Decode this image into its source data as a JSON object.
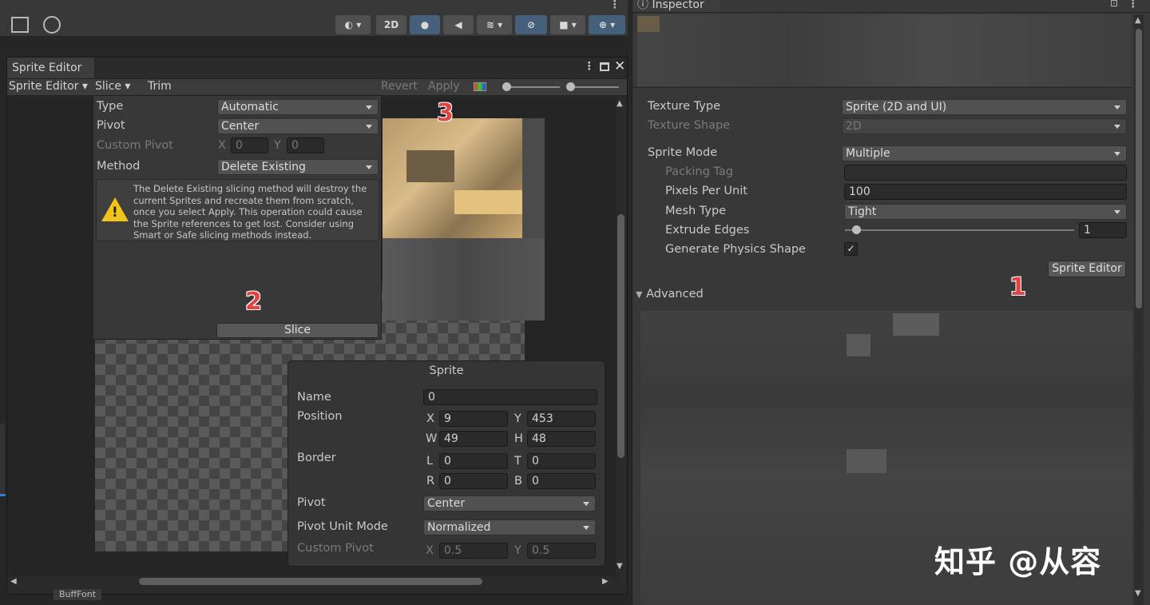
{
  "scene_toolbar": {
    "mode_2d": "2D"
  },
  "sprite_editor": {
    "tab_title": "Sprite Editor",
    "toolbar": {
      "mode_menu": "Sprite Editor",
      "slice": "Slice",
      "trim": "Trim",
      "revert": "Revert",
      "apply": "Apply"
    },
    "slice_popup": {
      "type_label": "Type",
      "type_value": "Automatic",
      "pivot_label": "Pivot",
      "pivot_value": "Center",
      "custom_pivot_label": "Custom Pivot",
      "cp_x_label": "X",
      "cp_x": "0",
      "cp_y_label": "Y",
      "cp_y": "0",
      "method_label": "Method",
      "method_value": "Delete Existing",
      "warning": "The Delete Existing slicing method will destroy the current Sprites and recreate them from scratch, once you select Apply. This operation could cause the Sprite references to get lost. Consider using Smart or Safe slicing methods instead.",
      "slice_button": "Slice"
    },
    "sprite_panel": {
      "title": "Sprite",
      "name_label": "Name",
      "name_value": "0",
      "position_label": "Position",
      "x_label": "X",
      "x": "9",
      "y_label": "Y",
      "y": "453",
      "w_label": "W",
      "w": "49",
      "h_label": "H",
      "h": "48",
      "border_label": "Border",
      "l_label": "L",
      "l": "0",
      "t_label": "T",
      "t": "0",
      "r_label": "R",
      "r": "0",
      "b_label": "B",
      "b": "0",
      "pivot_label": "Pivot",
      "pivot_value": "Center",
      "pivot_unit_label": "Pivot Unit Mode",
      "pivot_unit_value": "Normalized",
      "custom_pivot_label": "Custom Pivot",
      "cpx_label": "X",
      "cpx": "0.5",
      "cpy_label": "Y",
      "cpy": "0.5"
    },
    "asset_label": "BuffFont"
  },
  "inspector": {
    "tab_title": "Inspector",
    "texture_type_label": "Texture Type",
    "texture_type": "Sprite (2D and UI)",
    "texture_shape_label": "Texture Shape",
    "texture_shape": "2D",
    "sprite_mode_label": "Sprite Mode",
    "sprite_mode": "Multiple",
    "packing_tag_label": "Packing Tag",
    "packing_tag": "",
    "ppu_label": "Pixels Per Unit",
    "ppu": "100",
    "mesh_type_label": "Mesh Type",
    "mesh_type": "Tight",
    "extrude_label": "Extrude Edges",
    "extrude": "1",
    "physics_label": "Generate Physics Shape",
    "physics_checked": "✓",
    "sprite_editor_button": "Sprite Editor",
    "advanced_label": "Advanced"
  },
  "annotations": {
    "one": "1",
    "two": "2",
    "three": "3"
  },
  "watermark": "知乎 @从容"
}
